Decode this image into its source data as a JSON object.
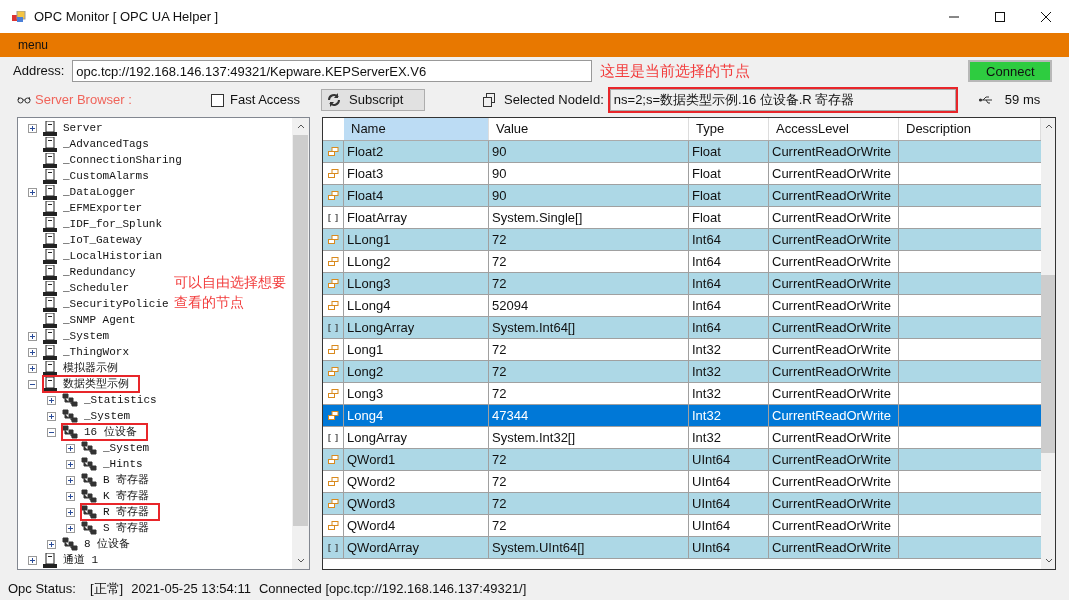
{
  "window": {
    "title": "OPC Monitor [ OPC UA Helper ]"
  },
  "menu": [
    "menu"
  ],
  "address": {
    "label": "Address:",
    "value": "opc.tcp://192.168.146.137:49321/Kepware.KEPServerEX.V6",
    "connect": "Connect"
  },
  "toolbar": {
    "browser_label": "Server Browser :",
    "fast_access": {
      "label": "Fast Access",
      "checked": false
    },
    "subscript": "Subscript",
    "nodeid_label": "Selected NodeId:",
    "nodeid_value": "ns=2;s=数据类型示例.16 位设备.R 寄存器",
    "nodeid_highlighted": true,
    "latency": "59 ms"
  },
  "annotations": {
    "node_hint": "这里是当前选择的节点",
    "tree_hint": "可以自由选择想要查看的节点"
  },
  "tree": [
    {
      "label": "Server",
      "kind": "server",
      "expanded": false
    },
    {
      "label": "_AdvancedTags",
      "kind": "server"
    },
    {
      "label": "_ConnectionSharing",
      "kind": "server"
    },
    {
      "label": "_CustomAlarms",
      "kind": "server"
    },
    {
      "label": "_DataLogger",
      "kind": "server",
      "expanded": false
    },
    {
      "label": "_EFMExporter",
      "kind": "server"
    },
    {
      "label": "_IDF_for_Splunk",
      "kind": "server"
    },
    {
      "label": "_IoT_Gateway",
      "kind": "server"
    },
    {
      "label": "_LocalHistorian",
      "kind": "server"
    },
    {
      "label": "_Redundancy",
      "kind": "server"
    },
    {
      "label": "_Scheduler",
      "kind": "server"
    },
    {
      "label": "_SecurityPolicie",
      "kind": "server"
    },
    {
      "label": "_SNMP Agent",
      "kind": "server"
    },
    {
      "label": "_System",
      "kind": "server",
      "expanded": false
    },
    {
      "label": "_ThingWorx",
      "kind": "server",
      "expanded": false
    },
    {
      "label": "模拟器示例",
      "kind": "server",
      "expanded": false
    },
    {
      "label": "数据类型示例",
      "kind": "server",
      "expanded": true,
      "highlighted": true,
      "children": [
        {
          "label": "_Statistics",
          "kind": "device",
          "expanded": false
        },
        {
          "label": "_System",
          "kind": "device",
          "expanded": false
        },
        {
          "label": "16 位设备",
          "kind": "device",
          "expanded": true,
          "highlighted": true,
          "children": [
            {
              "label": "_System",
              "kind": "device",
              "expanded": false
            },
            {
              "label": "_Hints",
              "kind": "device",
              "expanded": false
            },
            {
              "label": "B 寄存器",
              "kind": "device",
              "expanded": false
            },
            {
              "label": "K 寄存器",
              "kind": "device",
              "expanded": false
            },
            {
              "label": "R 寄存器",
              "kind": "device",
              "expanded": false,
              "highlighted": true
            },
            {
              "label": "S 寄存器",
              "kind": "device",
              "expanded": false
            }
          ]
        },
        {
          "label": "8 位设备",
          "kind": "device",
          "expanded": false
        }
      ]
    },
    {
      "label": "通道 1",
      "kind": "server",
      "expanded": false
    }
  ],
  "table": {
    "columns": [
      {
        "label": "Name",
        "selected": true
      },
      {
        "label": "Value",
        "selected": false
      },
      {
        "label": "Type",
        "selected": false
      },
      {
        "label": "AccessLevel",
        "selected": false
      },
      {
        "label": "Description",
        "selected": false
      }
    ],
    "rows": [
      {
        "kind": "variable",
        "name": "Float2",
        "value": "90",
        "type": "Float",
        "access": "CurrentReadOrWrite",
        "selected": false
      },
      {
        "kind": "variable",
        "name": "Float3",
        "value": "90",
        "type": "Float",
        "access": "CurrentReadOrWrite",
        "selected": false
      },
      {
        "kind": "variable",
        "name": "Float4",
        "value": "90",
        "type": "Float",
        "access": "CurrentReadOrWrite",
        "selected": false
      },
      {
        "kind": "array",
        "name": "FloatArray",
        "value": "System.Single[]",
        "type": "Float",
        "access": "CurrentReadOrWrite",
        "selected": false
      },
      {
        "kind": "variable",
        "name": "LLong1",
        "value": "72",
        "type": "Int64",
        "access": "CurrentReadOrWrite",
        "selected": false
      },
      {
        "kind": "variable",
        "name": "LLong2",
        "value": "72",
        "type": "Int64",
        "access": "CurrentReadOrWrite",
        "selected": false
      },
      {
        "kind": "variable",
        "name": "LLong3",
        "value": "72",
        "type": "Int64",
        "access": "CurrentReadOrWrite",
        "selected": false
      },
      {
        "kind": "variable",
        "name": "LLong4",
        "value": "52094",
        "type": "Int64",
        "access": "CurrentReadOrWrite",
        "selected": false
      },
      {
        "kind": "array",
        "name": "LLongArray",
        "value": "System.Int64[]",
        "type": "Int64",
        "access": "CurrentReadOrWrite",
        "selected": false
      },
      {
        "kind": "variable",
        "name": "Long1",
        "value": "72",
        "type": "Int32",
        "access": "CurrentReadOrWrite",
        "selected": false
      },
      {
        "kind": "variable",
        "name": "Long2",
        "value": "72",
        "type": "Int32",
        "access": "CurrentReadOrWrite",
        "selected": false
      },
      {
        "kind": "variable",
        "name": "Long3",
        "value": "72",
        "type": "Int32",
        "access": "CurrentReadOrWrite",
        "selected": false
      },
      {
        "kind": "variable",
        "name": "Long4",
        "value": "47344",
        "type": "Int32",
        "access": "CurrentReadOrWrite",
        "selected": true
      },
      {
        "kind": "array",
        "name": "LongArray",
        "value": "System.Int32[]",
        "type": "Int32",
        "access": "CurrentReadOrWrite",
        "selected": false
      },
      {
        "kind": "variable",
        "name": "QWord1",
        "value": "72",
        "type": "UInt64",
        "access": "CurrentReadOrWrite",
        "selected": false
      },
      {
        "kind": "variable",
        "name": "QWord2",
        "value": "72",
        "type": "UInt64",
        "access": "CurrentReadOrWrite",
        "selected": false
      },
      {
        "kind": "variable",
        "name": "QWord3",
        "value": "72",
        "type": "UInt64",
        "access": "CurrentReadOrWrite",
        "selected": false
      },
      {
        "kind": "variable",
        "name": "QWord4",
        "value": "72",
        "type": "UInt64",
        "access": "CurrentReadOrWrite",
        "selected": false
      },
      {
        "kind": "array",
        "name": "QWordArray",
        "value": "System.UInt64[]",
        "type": "UInt64",
        "access": "CurrentReadOrWrite",
        "selected": false
      }
    ]
  },
  "status_bar": {
    "label": "Opc Status:",
    "state": "[正常]",
    "time": "2021-05-25 13:54:11",
    "connection": "Connected [opc.tcp://192.168.146.137:49321/]"
  }
}
